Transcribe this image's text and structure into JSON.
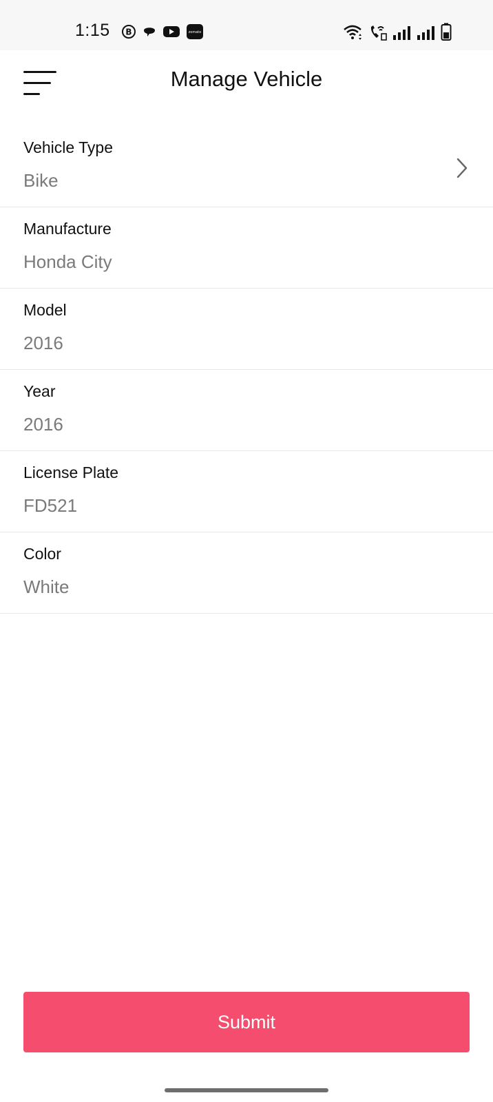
{
  "status_bar": {
    "time": "1:15",
    "left_icons": [
      "b-circle-icon",
      "chat-bubble-icon",
      "youtube-icon",
      "zomato-icon"
    ],
    "zomato_label": "zomato",
    "right_icons": [
      "wifi-icon",
      "wifi-call-icon",
      "signal-icon",
      "signal-icon",
      "battery-icon"
    ]
  },
  "header": {
    "title": "Manage Vehicle",
    "menu_icon": "menu-icon"
  },
  "fields": [
    {
      "label": "Vehicle Type",
      "value": "Bike",
      "has_chevron": true
    },
    {
      "label": "Manufacture",
      "value": "Honda City"
    },
    {
      "label": "Model",
      "value": "2016"
    },
    {
      "label": "Year",
      "value": "2016"
    },
    {
      "label": "License Plate",
      "value": "FD521"
    },
    {
      "label": "Color",
      "value": "White"
    }
  ],
  "submit": {
    "label": "Submit",
    "color": "#f44d6e"
  }
}
